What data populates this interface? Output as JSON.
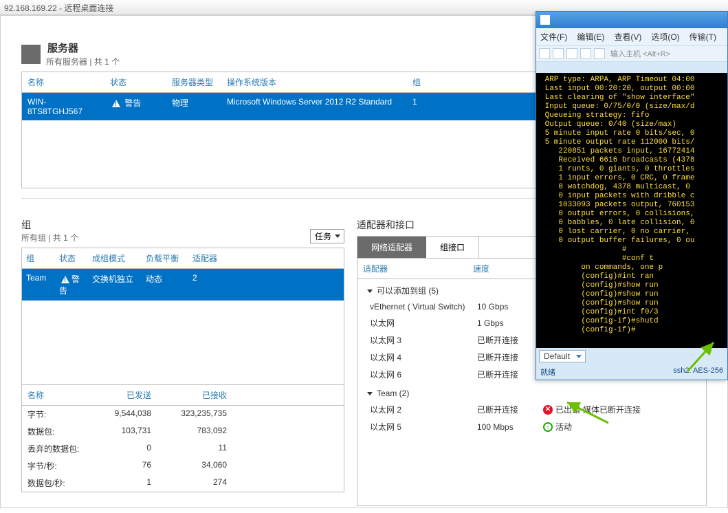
{
  "rdp_title": "92.168.169.22 - 远程桌面连接",
  "servers": {
    "title": "服务器",
    "subtitle": "所有服务器 | 共 1 个",
    "columns": {
      "name": "名称",
      "status": "状态",
      "type": "服务器类型",
      "os": "操作系统版本",
      "group": "组"
    },
    "row": {
      "name": "WIN-8TS8TGHJ567",
      "status": "警告",
      "type": "物理",
      "os": "Microsoft Windows Server 2012 R2 Standard",
      "group": "1"
    }
  },
  "groups": {
    "title": "组",
    "subtitle": "所有组 | 共 1 个",
    "tasks_label": "任务",
    "columns": {
      "group": "组",
      "status": "状态",
      "mode": "成组模式",
      "lb": "负载平衡",
      "adapter": "适配器"
    },
    "row": {
      "group": "Team",
      "status": "警告",
      "mode": "交换机独立",
      "lb": "动态",
      "adapter": "2"
    }
  },
  "stats": {
    "columns": {
      "name": "名称",
      "sent": "已发送",
      "recv": "已接收"
    },
    "rows": [
      {
        "name": "字节:",
        "sent": "9,544,038",
        "recv": "323,235,735"
      },
      {
        "name": "数据包:",
        "sent": "103,731",
        "recv": "783,092"
      },
      {
        "name": "丢弃的数据包:",
        "sent": "0",
        "recv": "11"
      },
      {
        "name": "字节/秒:",
        "sent": "76",
        "recv": "34,060"
      },
      {
        "name": "数据包/秒:",
        "sent": "1",
        "recv": "274"
      }
    ]
  },
  "adapters": {
    "title": "适配器和接口",
    "tabs": {
      "net": "网络适配器",
      "team": "组接口"
    },
    "columns": {
      "adapter": "适配器",
      "speed": "速度"
    },
    "group1": "可以添加到组 (5)",
    "rows1": [
      {
        "name": "vEthernet ( Virtual Switch)",
        "speed": "10 Gbps"
      },
      {
        "name": "以太网",
        "speed": "1 Gbps"
      },
      {
        "name": "以太网 3",
        "speed": "已断开连接"
      },
      {
        "name": "以太网 4",
        "speed": "已断开连接"
      },
      {
        "name": "以太网 6",
        "speed": "已断开连接"
      }
    ],
    "group2": "Team (2)",
    "rows2": [
      {
        "name": "以太网 2",
        "speed": "已断开连接",
        "status_icon": "error",
        "status_label": "已出错",
        "extra": "媒体已断开连接"
      },
      {
        "name": "以太网 5",
        "speed": "100 Mbps",
        "status_icon": "ok",
        "status_label": "活动",
        "extra": ""
      }
    ]
  },
  "terminal": {
    "menu": [
      "文件(F)",
      "编辑(E)",
      "查看(V)",
      "选项(O)",
      "传输(T)"
    ],
    "host_placeholder": "输入主机 <Alt+R>",
    "body": " ARP type: ARPA, ARP Timeout 04:00\n Last input 00:20:20, output 00:00\n Last clearing of \"show interface\"\n Input queue: 0/75/0/0 (size/max/d\n Queueing strategy: fifo\n Output queue: 0/40 (size/max)\n 5 minute input rate 0 bits/sec, 0\n 5 minute output rate 112000 bits/\n    220851 packets input, 16772414\n    Received 6616 broadcasts (4378\n    1 runts, 0 giants, 0 throttles\n    1 input errors, 0 CRC, 0 frame\n    0 watchdog, 4378 multicast, 0 \n    0 input packets with dribble c\n    1033093 packets output, 760153\n    0 output errors, 0 collisions,\n    0 babbles, 0 late collision, 0\n    0 lost carrier, 0 no carrier, \n    0 output buffer failures, 0 ou\n                  #\n                  #conf t\n         on commands, one p\n         (config)#int ran  \n         (config)#show run \n         (config)#show run \n         (config)#show run \n         (config)#int f0/3 \n         (config-if)#shutd \n         (config-if)#",
    "selector": "Default",
    "status_left": "就绪",
    "status_right": "ssh2: AES-256"
  }
}
